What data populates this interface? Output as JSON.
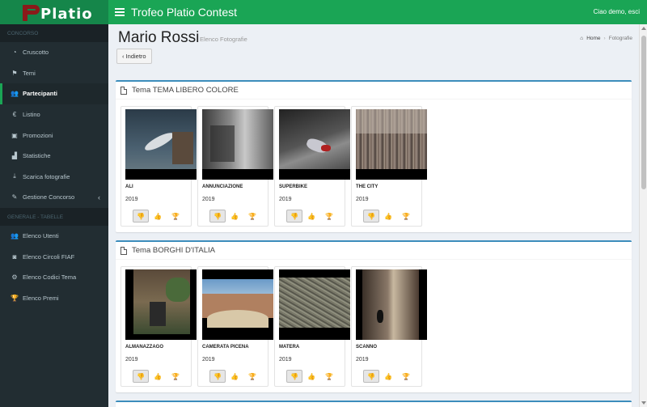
{
  "header": {
    "logo_text": "Platio",
    "title": "Trofeo Platio Contest",
    "user_link": "Ciao demo, esci"
  },
  "sidebar": {
    "section1": "CONCORSO",
    "items1": [
      {
        "label": "Cruscotto",
        "icon": "dashboard-icon"
      },
      {
        "label": "Temi",
        "icon": "flag-icon"
      },
      {
        "label": "Partecipanti",
        "icon": "users-icon",
        "active": true
      },
      {
        "label": "Listino",
        "icon": "euro-icon"
      },
      {
        "label": "Promozioni",
        "icon": "ticket-icon"
      },
      {
        "label": "Statistiche",
        "icon": "chart-icon"
      },
      {
        "label": "Scarica fotografie",
        "icon": "download-icon"
      },
      {
        "label": "Gestione Concorso",
        "icon": "edit-icon"
      }
    ],
    "section2": "GENERALE - TABELLE",
    "items2": [
      {
        "label": "Elenco Utenti",
        "icon": "users-icon"
      },
      {
        "label": "Elenco Circoli FIAF",
        "icon": "camera-icon"
      },
      {
        "label": "Elenco Codici Tema",
        "icon": "gear-icon"
      },
      {
        "label": "Elenco Premi",
        "icon": "trophy-icon"
      }
    ]
  },
  "page": {
    "title": "Mario Rossi",
    "subtitle": "Elenco Fotografie",
    "back_label": "‹ Indietro",
    "breadcrumb": {
      "home": "Home",
      "current": "Fotografie"
    }
  },
  "themes": [
    {
      "title": "Tema TEMA LIBERO COLORE",
      "photos": [
        {
          "name": "ALI",
          "year": "2019"
        },
        {
          "name": "ANNUNCIAZIONE",
          "year": "2019"
        },
        {
          "name": "SUPERBIKE",
          "year": "2019"
        },
        {
          "name": "THE CITY",
          "year": "2019"
        }
      ]
    },
    {
      "title": "Tema BORGHI D'ITALIA",
      "photos": [
        {
          "name": "ALMANAZZAGO",
          "year": "2019"
        },
        {
          "name": "CAMERATA PICENA",
          "year": "2019"
        },
        {
          "name": "MATERA",
          "year": "2019"
        },
        {
          "name": "SCANNO",
          "year": "2019"
        }
      ]
    }
  ],
  "colors": {
    "header": "#1aa555",
    "logo_bg": "#15864a",
    "sidebar": "#222d32",
    "box_border": "#3c8dbc"
  }
}
